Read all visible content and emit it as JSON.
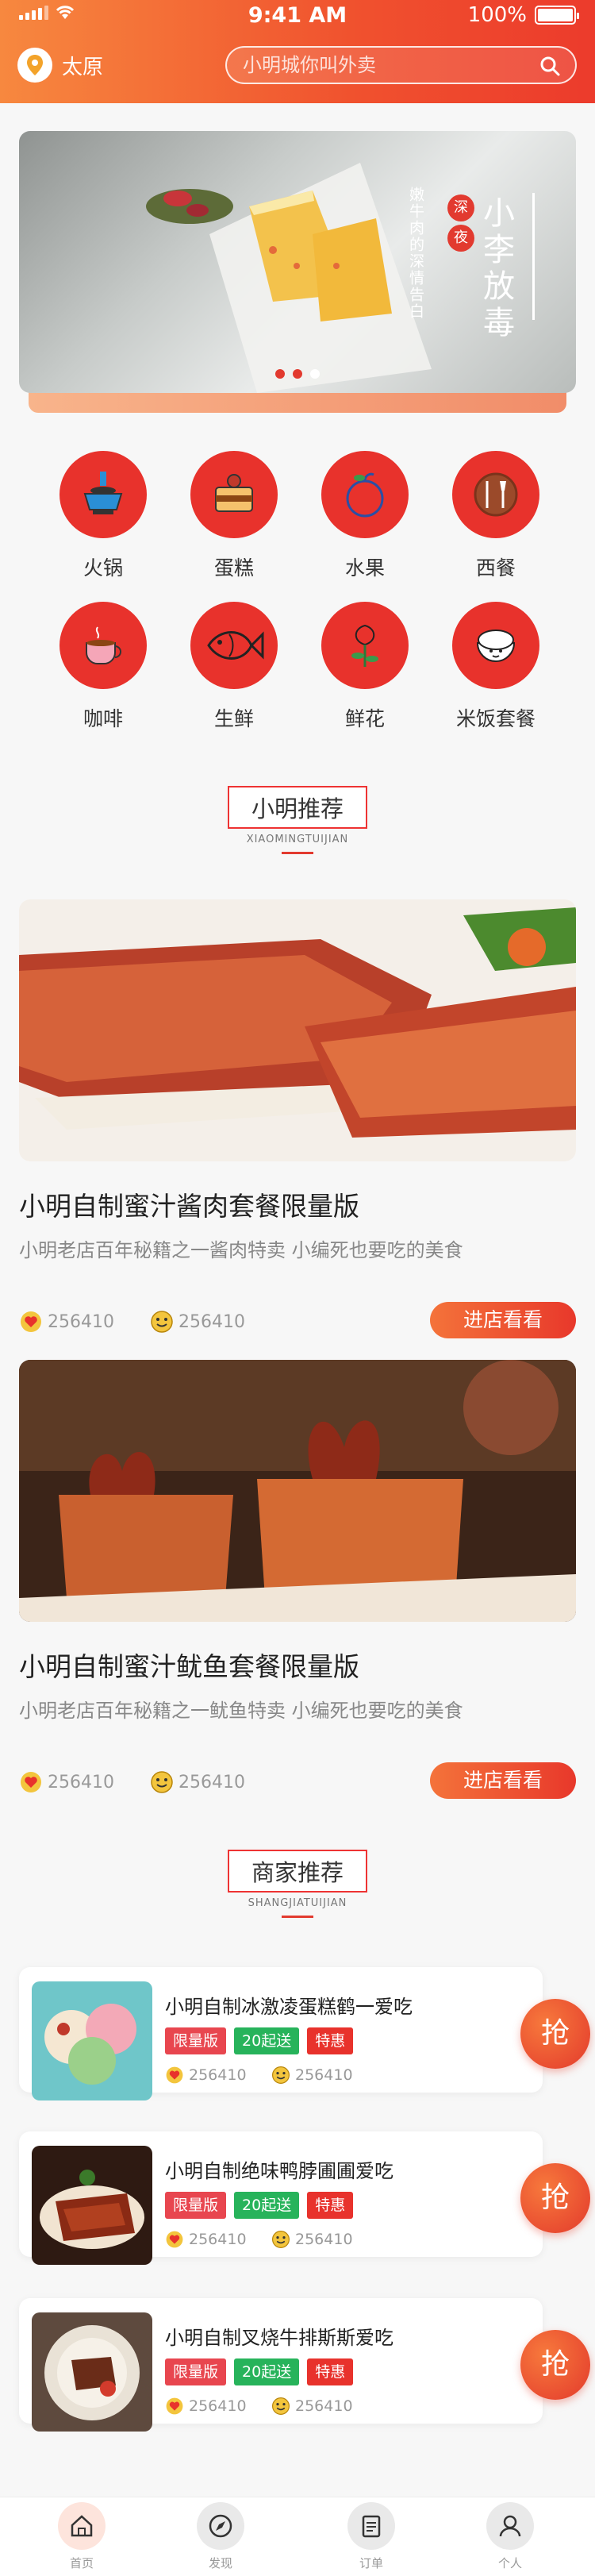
{
  "status_bar": {
    "carrier": "••••",
    "time": "9:41 AM",
    "battery": "100%"
  },
  "header": {
    "city": "太原",
    "search_placeholder": "小明城你叫外卖"
  },
  "banner": {
    "big_text": "小李放毒",
    "small_text": "嫩牛肉的深情告白",
    "badge1": "深",
    "badge2": "夜",
    "active_dot": 2
  },
  "categories": [
    {
      "label": "火锅",
      "icon": "hotpot-icon"
    },
    {
      "label": "蛋糕",
      "icon": "cake-icon"
    },
    {
      "label": "水果",
      "icon": "fruit-icon"
    },
    {
      "label": "西餐",
      "icon": "western-food-icon"
    },
    {
      "label": "咖啡",
      "icon": "coffee-icon"
    },
    {
      "label": "生鲜",
      "icon": "fish-icon"
    },
    {
      "label": "鲜花",
      "icon": "flower-icon"
    },
    {
      "label": "米饭套餐",
      "icon": "rice-icon"
    }
  ],
  "recommend": {
    "title": "小明推荐",
    "subtitle": "XIAOMINGTUIJIAN",
    "items": [
      {
        "title": "小明自制蜜汁酱肉套餐限量版",
        "subtitle": "小明老店百年秘籍之一酱肉特卖   小编死也要吃的美食",
        "likes": "256410",
        "smiles": "256410",
        "button": "进店看看"
      },
      {
        "title": "小明自制蜜汁鱿鱼套餐限量版",
        "subtitle": "小明老店百年秘籍之一鱿鱼特卖   小编死也要吃的美食",
        "likes": "256410",
        "smiles": "256410",
        "button": "进店看看"
      }
    ]
  },
  "shops": {
    "title": "商家推荐",
    "subtitle": "SHANGJIATUIJIAN",
    "items": [
      {
        "name": "小明自制冰激凌蛋糕鹤一爱吃",
        "tags": [
          "限量版",
          "20起送",
          "特惠"
        ],
        "likes": "256410",
        "smiles": "256410",
        "grab": "抢"
      },
      {
        "name": "小明自制绝味鸭脖圃圃爱吃",
        "tags": [
          "限量版",
          "20起送",
          "特惠"
        ],
        "likes": "256410",
        "smiles": "256410",
        "grab": "抢"
      },
      {
        "name": "小明自制叉烧牛排斯斯爱吃",
        "tags": [
          "限量版",
          "20起送",
          "特惠"
        ],
        "likes": "256410",
        "smiles": "256410",
        "grab": "抢"
      }
    ]
  },
  "tabbar": [
    {
      "label": "首页",
      "active": true
    },
    {
      "label": "发现",
      "active": false
    },
    {
      "label": "订单",
      "active": false
    },
    {
      "label": "个人",
      "active": false
    }
  ],
  "colors": {
    "accent": "#e8322c",
    "accent_orange": "#f4733a",
    "tag_green": "#27b35b"
  }
}
